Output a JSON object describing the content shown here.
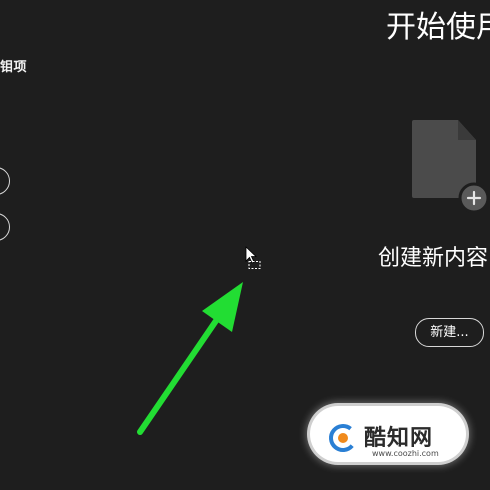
{
  "sidebar": {
    "label": "钼项"
  },
  "start": {
    "title": "开始使用",
    "create_label": "创建新内容",
    "new_button_label": "新建..."
  },
  "watermark": {
    "brand": "酷知网",
    "url": "www.coozhi.com"
  },
  "colors": {
    "background": "#1e1e1e",
    "doc_icon": "#4b4b4b",
    "plus_badge": "#5a5a5a",
    "arrow": "#22dd33",
    "watermark_blue": "#2a7fd4",
    "watermark_orange": "#f08a1c"
  },
  "icons": {
    "doc": "new-document-icon",
    "plus": "plus-icon",
    "cursor": "mouse-cursor-icon",
    "annotation": "green-arrow-icon",
    "logo": "coozhi-logo-icon"
  }
}
